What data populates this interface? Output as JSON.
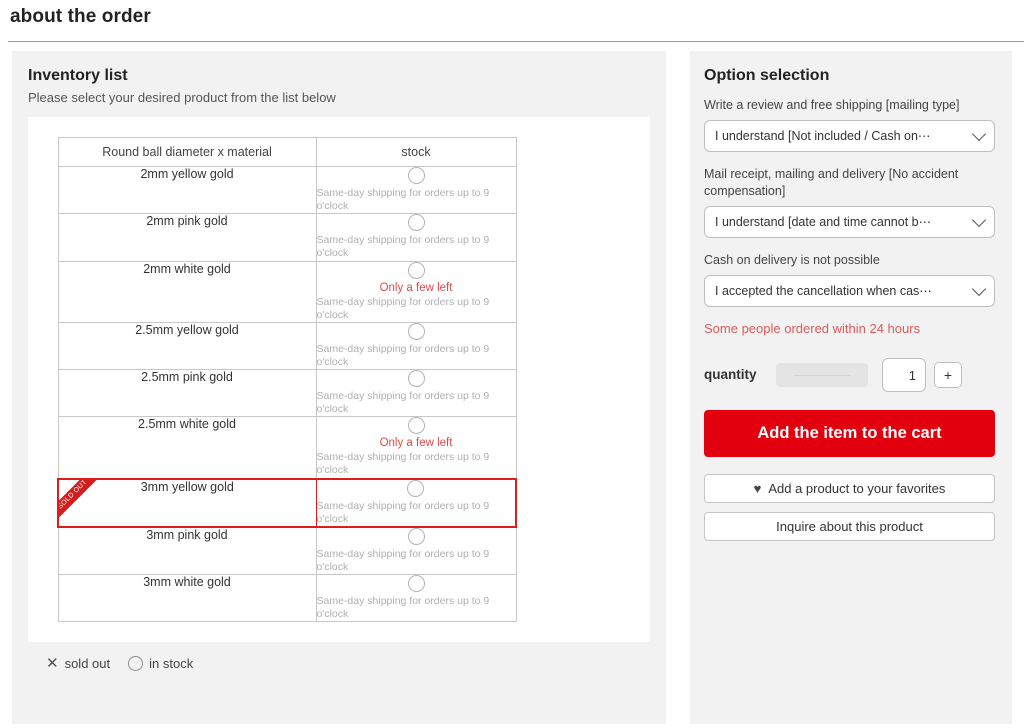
{
  "page": {
    "title": "about the order"
  },
  "inventory": {
    "heading": "Inventory list",
    "subheading": "Please select your desired product from the list below",
    "columns": [
      "Round ball diameter x material",
      "stock"
    ],
    "ship_note": "Same-day shipping for orders up to 9 o'clock",
    "few_left_label": "Only a few left",
    "ribbon_label": "SOLD OUT",
    "rows": [
      {
        "name": "2mm yellow gold",
        "few_left": false,
        "selected": false,
        "sold_out": false
      },
      {
        "name": "2mm pink gold",
        "few_left": false,
        "selected": false,
        "sold_out": false
      },
      {
        "name": "2mm white gold",
        "few_left": true,
        "selected": false,
        "sold_out": false
      },
      {
        "name": "2.5mm yellow gold",
        "few_left": false,
        "selected": false,
        "sold_out": false
      },
      {
        "name": "2.5mm pink gold",
        "few_left": false,
        "selected": false,
        "sold_out": false
      },
      {
        "name": "2.5mm white gold",
        "few_left": true,
        "selected": false,
        "sold_out": false
      },
      {
        "name": "3mm yellow gold",
        "few_left": false,
        "selected": true,
        "sold_out": true
      },
      {
        "name": "3mm pink gold",
        "few_left": false,
        "selected": false,
        "sold_out": false
      },
      {
        "name": "3mm white gold",
        "few_left": false,
        "selected": false,
        "sold_out": false
      }
    ],
    "legend": {
      "sold_out_icon": "x-icon",
      "sold_out_label": "sold out",
      "in_stock_icon": "circle-icon",
      "in_stock_label": "in stock"
    }
  },
  "options": {
    "heading": "Option selection",
    "fields": [
      {
        "label": "Write a review and free shipping [mailing type]",
        "value": "I understand [Not included / Cash on⋯"
      },
      {
        "label": "Mail receipt, mailing and delivery [No accident compensation]",
        "value": "I understand [date and time cannot b⋯"
      },
      {
        "label": "Cash on delivery is not possible",
        "value": "I accepted the cancellation when cas⋯"
      }
    ],
    "alert": "Some people ordered within 24 hours",
    "quantity": {
      "label": "quantity",
      "value": "1",
      "plus_label": "+"
    },
    "cart_button": "Add the item to the cart",
    "favorite_button": "Add a product to your favorites",
    "favorite_icon": "heart-icon",
    "inquire_button": "Inquire about this product"
  },
  "colors": {
    "accent_red": "#e2000f",
    "alert_red": "#e05a5a",
    "panel_bg": "#f2f2f2"
  }
}
